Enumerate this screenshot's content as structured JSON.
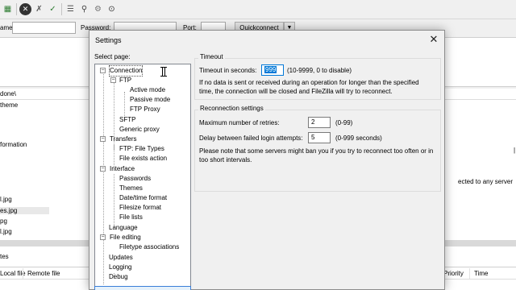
{
  "toolbar": {
    "icons": [
      "site-manager-icon",
      "disconnect-icon",
      "cancel-icon",
      "process-queue-icon",
      "filter-icon",
      "search-icon",
      "settings-icon",
      "find-files-icon"
    ]
  },
  "quickconnect": {
    "host_label": "ame:",
    "password_label": "Password:",
    "port_label": "Port:",
    "button_label": "Quickconnect",
    "dropdown_icon": "chevron-down-icon"
  },
  "background": {
    "remote_path": "done\\",
    "tree_item_1": "theme",
    "tree_item_2": "formation",
    "status_text": "ected to any server",
    "files": [
      "l.jpg",
      "es.jpg",
      "pg",
      "l.jpg"
    ],
    "tab_files": "tes",
    "queue_columns": {
      "local_file": "Local file",
      "remote_file": "Remote file",
      "priority": "Priority",
      "time": "Time"
    }
  },
  "dialog": {
    "title": "Settings",
    "close_icon": "close-icon",
    "select_page_label": "Select page:",
    "tree": [
      {
        "label": "Connection",
        "level": 0,
        "expanded": true,
        "selected": true
      },
      {
        "label": "FTP",
        "level": 1,
        "expanded": true
      },
      {
        "label": "Active mode",
        "level": 2
      },
      {
        "label": "Passive mode",
        "level": 2
      },
      {
        "label": "FTP Proxy",
        "level": 2
      },
      {
        "label": "SFTP",
        "level": 1
      },
      {
        "label": "Generic proxy",
        "level": 1
      },
      {
        "label": "Transfers",
        "level": 0,
        "expanded": true
      },
      {
        "label": "FTP: File Types",
        "level": 1
      },
      {
        "label": "File exists action",
        "level": 1
      },
      {
        "label": "Interface",
        "level": 0,
        "expanded": true
      },
      {
        "label": "Passwords",
        "level": 1
      },
      {
        "label": "Themes",
        "level": 1
      },
      {
        "label": "Date/time format",
        "level": 1
      },
      {
        "label": "Filesize format",
        "level": 1
      },
      {
        "label": "File lists",
        "level": 1
      },
      {
        "label": "Language",
        "level": 0
      },
      {
        "label": "File editing",
        "level": 0,
        "expanded": true
      },
      {
        "label": "Filetype associations",
        "level": 1
      },
      {
        "label": "Updates",
        "level": 0
      },
      {
        "label": "Logging",
        "level": 0
      },
      {
        "label": "Debug",
        "level": 0
      }
    ],
    "timeout": {
      "group_title": "Timeout",
      "label": "Timeout in seconds:",
      "value": "999",
      "hint": "(10-9999, 0 to disable)",
      "description": "If no data is sent or received during an operation for longer than the specified time, the connection will be closed and FileZilla will try to reconnect."
    },
    "reconnect": {
      "group_title": "Reconnection settings",
      "retries_label": "Maximum number of retries:",
      "retries_value": "2",
      "retries_hint": "(0-99)",
      "delay_label": "Delay between failed login attempts:",
      "delay_value": "5",
      "delay_hint": "(0-999 seconds)",
      "note": "Please note that some servers might ban you if you try to reconnect too often or in too short intervals."
    }
  }
}
